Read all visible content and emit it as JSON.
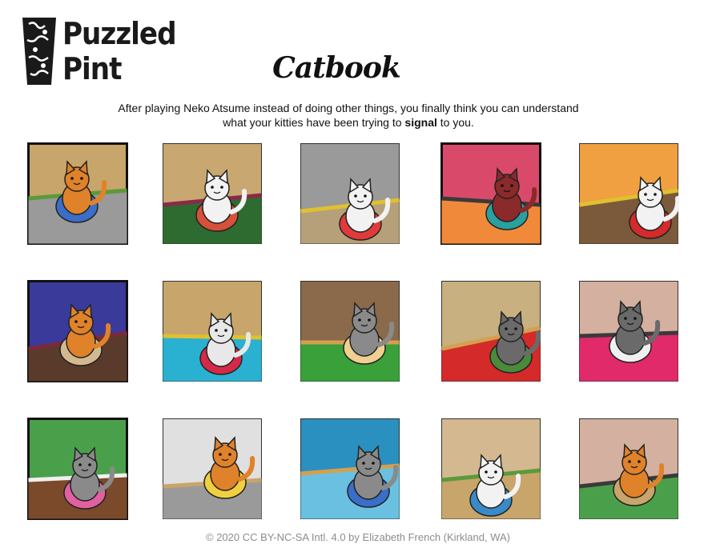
{
  "logo": {
    "line1": "Puzzled",
    "line2": "Pint"
  },
  "title": "Catbook",
  "intro": {
    "line1": "After playing Neko Atsume instead of doing other things, you finally think you can understand",
    "line2_before": "what your kitties have been trying to ",
    "line2_bold": "signal",
    "line2_after": " to you."
  },
  "footer": "© 2020 CC BY-NC-SA Intl. 4.0 by Elizabeth French (Kirkland, WA)",
  "tiles": [
    {
      "bg": "#c8a56a",
      "floor": "#9a9a9a",
      "cat": "#e0822a",
      "accent": "#3a6ec8",
      "trim": "#5a9a3a"
    },
    {
      "bg": "#c9a771",
      "floor": "#2e6b30",
      "cat": "#f2f2f2",
      "accent": "#d6503a",
      "trim": "#8a2a4a"
    },
    {
      "bg": "#9a9a9a",
      "floor": "#b5a07a",
      "cat": "#f2f2f2",
      "accent": "#e03a3a",
      "trim": "#e0c030"
    },
    {
      "bg": "#d94a6a",
      "floor": "#f08a3a",
      "cat": "#8a2a2a",
      "accent": "#2aa0a0",
      "trim": "#3a3a3a"
    },
    {
      "bg": "#f0a040",
      "floor": "#7a5a3a",
      "cat": "#f2f2f2",
      "accent": "#d42a2a",
      "trim": "#e0c030"
    },
    {
      "bg": "#3a3a9a",
      "floor": "#5a3a2a",
      "cat": "#e0822a",
      "accent": "#d4b890",
      "trim": "#7a2a3a"
    },
    {
      "bg": "#c8a56a",
      "floor": "#2ab0d0",
      "cat": "#e8e8e8",
      "accent": "#d42a4a",
      "trim": "#e0c030"
    },
    {
      "bg": "#8a6a4a",
      "floor": "#3aa03a",
      "cat": "#8a8a8a",
      "accent": "#f0d090",
      "trim": "#d4a050"
    },
    {
      "bg": "#c8b080",
      "floor": "#d42a2a",
      "cat": "#6a6a6a",
      "accent": "#4a8a3a",
      "trim": "#d4a050"
    },
    {
      "bg": "#d4b0a0",
      "floor": "#e02a6a",
      "cat": "#6a6a6a",
      "accent": "#f0f0f0",
      "trim": "#3a3a3a"
    },
    {
      "bg": "#4aa04a",
      "floor": "#7a4a2a",
      "cat": "#8a8a8a",
      "accent": "#e060a0",
      "trim": "#f0f0f0"
    },
    {
      "bg": "#e0e0e0",
      "floor": "#9a9a9a",
      "cat": "#e0822a",
      "accent": "#f0d040",
      "trim": "#c8a56a"
    },
    {
      "bg": "#2a90c0",
      "floor": "#6ac0e0",
      "cat": "#8a8a8a",
      "accent": "#3a6ec8",
      "trim": "#d4a050"
    },
    {
      "bg": "#d4b890",
      "floor": "#c8a56a",
      "cat": "#f2f2f2",
      "accent": "#3a8ac8",
      "trim": "#5a9a3a"
    },
    {
      "bg": "#d4b0a0",
      "floor": "#4aa04a",
      "cat": "#e0822a",
      "accent": "#c8a56a",
      "trim": "#3a3a3a"
    }
  ]
}
